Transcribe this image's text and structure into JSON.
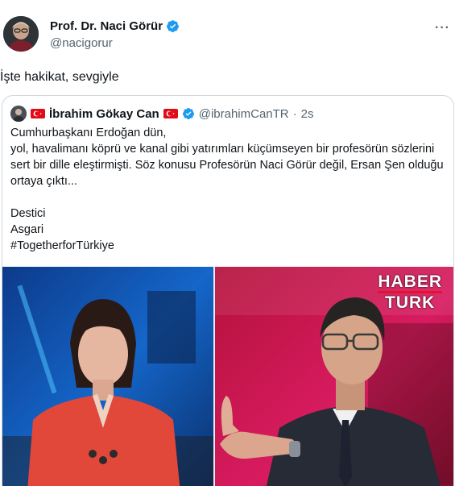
{
  "author": {
    "name": "Prof. Dr. Naci Görür",
    "handle": "@nacigorur",
    "avatar_icon": "profile-photo",
    "verified_icon": "verified-badge-icon",
    "more_label": "···"
  },
  "tweet": {
    "text": "İşte hakikat, sevgiyle"
  },
  "quote": {
    "name": "İbrahim Gökay Can",
    "handle": "@ibrahimCanTR",
    "separator": "·",
    "time": "2s",
    "body": "Cumhurbaşkanı Erdoğan dün,\n yol, havalimanı köprü ve kanal gibi yatırımları küçümseyen bir profesörün sözlerini sert bir dille eleştirmişti. Söz konusu Profesörün Naci Görür değil, Ersan Şen olduğu ortaya çıktı...\n\nDestici\nAsgari\n#TogetherforTürkiye",
    "flag_color": "#e30a17"
  },
  "media": {
    "brand_line1": "HABER",
    "brand_line2": "TURK",
    "brand_accent": "#e8112d"
  },
  "colors": {
    "verified": "#1d9bf0",
    "secondary_text": "#536471",
    "border": "#cfd9de"
  }
}
